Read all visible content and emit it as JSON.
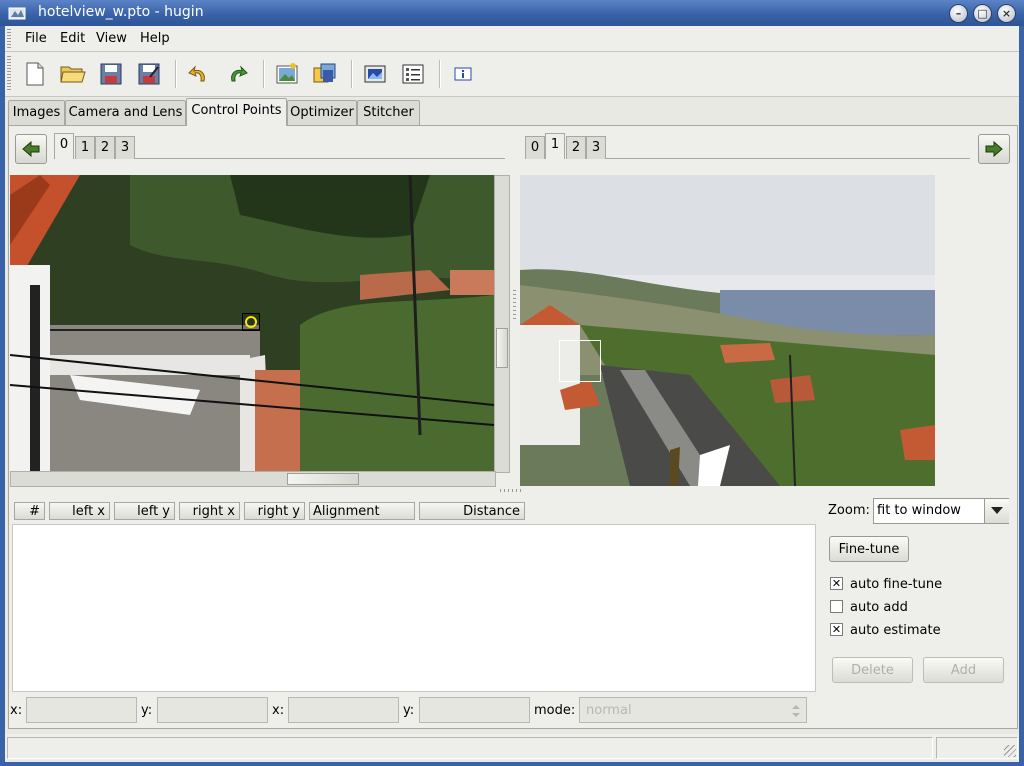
{
  "window": {
    "title": "hotelview_w.pto - hugin"
  },
  "menu": [
    "File",
    "Edit",
    "View",
    "Help"
  ],
  "toolbar": {
    "icons": [
      "new-file-icon",
      "open-folder-icon",
      "save-icon",
      "save-as-icon",
      "undo-icon",
      "redo-icon",
      "add-image-icon",
      "add-series-icon",
      "preview-icon",
      "list-icon",
      "info-icon"
    ]
  },
  "tabs": [
    "Images",
    "Camera and Lens",
    "Control Points",
    "Optimizer",
    "Stitcher"
  ],
  "active_tab": "Control Points",
  "left_image_tabs": [
    "0",
    "1",
    "2",
    "3"
  ],
  "left_active": "0",
  "right_image_tabs": [
    "0",
    "1",
    "2",
    "3"
  ],
  "right_active": "1",
  "table": {
    "headers": [
      "#",
      "left x",
      "left y",
      "right x",
      "right y",
      "Alignment",
      "Distance"
    ]
  },
  "zoom": {
    "label": "Zoom:",
    "value": "fit to window"
  },
  "fine_tune_label": "Fine-tune",
  "options": [
    {
      "label": "auto fine-tune",
      "checked": true
    },
    {
      "label": "auto add",
      "checked": false
    },
    {
      "label": "auto estimate",
      "checked": true
    }
  ],
  "delete_label": "Delete",
  "add_label": "Add",
  "coords": {
    "x1_label": "x:",
    "y1_label": "y:",
    "x2_label": "x:",
    "y2_label": "y:",
    "mode_label": "mode:",
    "mode_value": "normal"
  },
  "colors": {
    "titlebar": "#3a62a8",
    "accent_marker": "#ffe600"
  }
}
